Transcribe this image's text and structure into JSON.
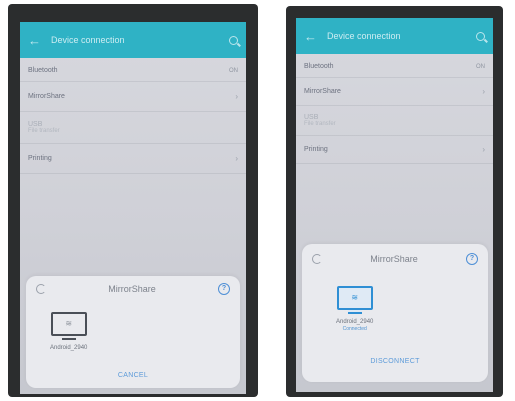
{
  "left_screen": {
    "header": {
      "title": "Device connection",
      "search_icon": "search-icon",
      "back_icon": "back-arrow-icon"
    },
    "settings": [
      {
        "label": "Bluetooth",
        "state": "ON"
      },
      {
        "label": "MirrorShare",
        "state": ""
      },
      {
        "label": "USB",
        "sub": "File transfer"
      },
      {
        "label": "Printing",
        "state": ""
      }
    ],
    "dialog": {
      "title": "MirrorShare",
      "device_name": "Android_2940",
      "action": "CANCEL"
    }
  },
  "right_screen": {
    "header": {
      "title": "Device connection",
      "search_icon": "search-icon",
      "back_icon": "back-arrow-icon"
    },
    "settings": [
      {
        "label": "Bluetooth",
        "state": "ON"
      },
      {
        "label": "MirrorShare",
        "state": ""
      },
      {
        "label": "USB",
        "sub": "File transfer"
      },
      {
        "label": "Printing",
        "state": ""
      }
    ],
    "dialog": {
      "title": "MirrorShare",
      "device_name": "Android_2940",
      "device_status": "Connected",
      "action": "DISCONNECT"
    }
  },
  "colors": {
    "appbar": "#2fb2c5",
    "accent": "#4e8fd6",
    "dialog": "#e9eaee"
  }
}
